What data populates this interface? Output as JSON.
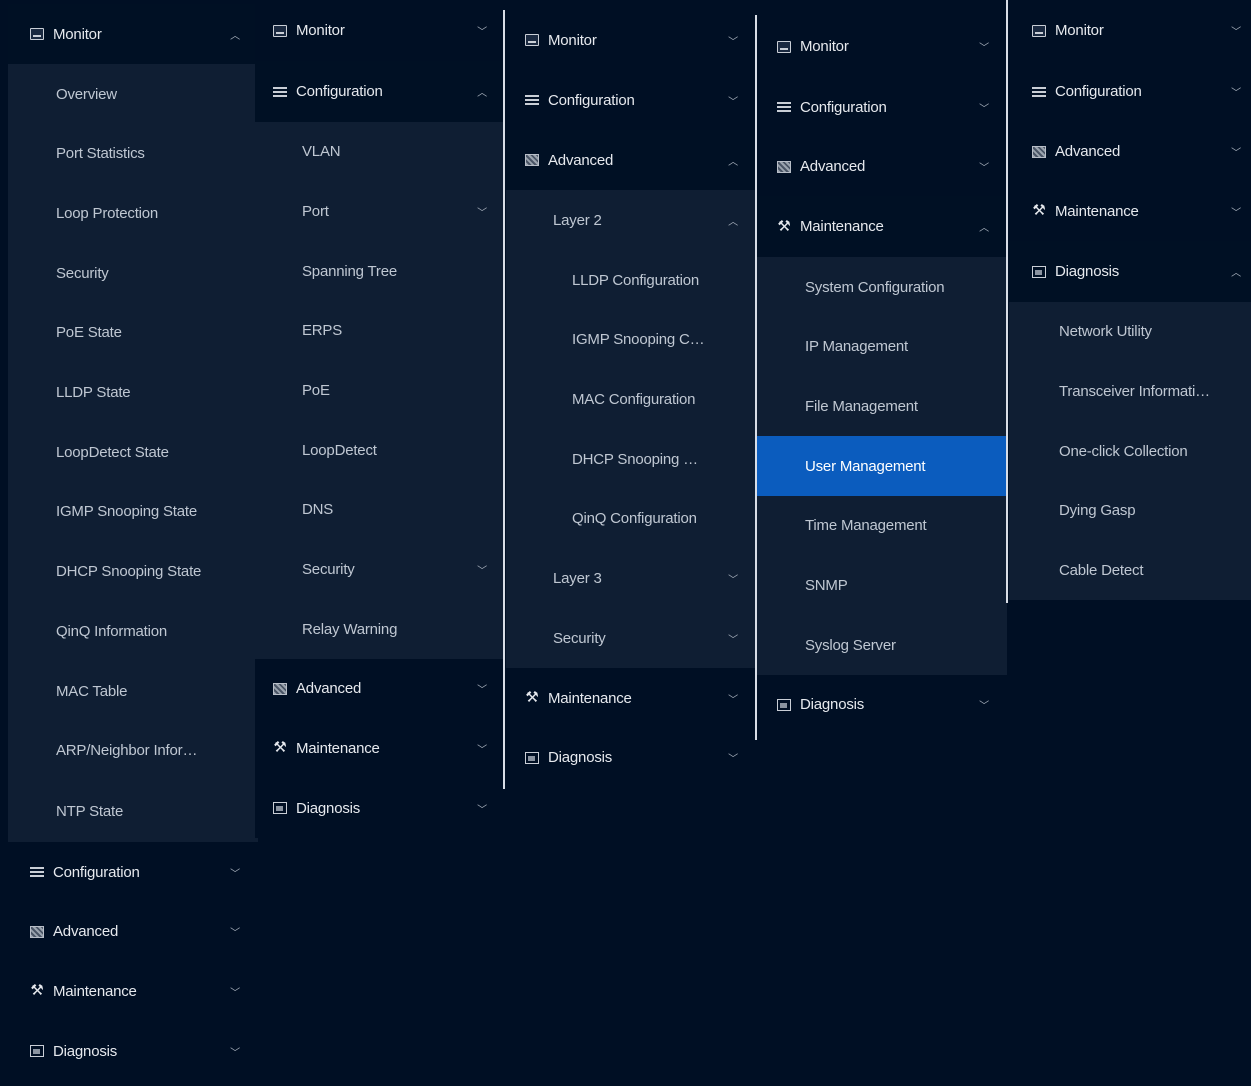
{
  "icons": {
    "monitor": "monitor-icon",
    "configuration": "configuration-icon",
    "advanced": "advanced-icon",
    "maintenance": "maintenance-icon",
    "diagnosis": "diagnosis-icon"
  },
  "colors": {
    "background": "#000f24",
    "submenu": "#0f1e33",
    "active": "#0b5cbe"
  },
  "panel1": {
    "monitor": "Monitor",
    "items": [
      "Overview",
      "Port Statistics",
      "Loop Protection",
      "Security",
      "PoE State",
      "LLDP State",
      "LoopDetect State",
      "IGMP Snooping State",
      "DHCP Snooping State",
      "QinQ Information",
      "MAC Table",
      "ARP/Neighbor Infor…",
      "NTP State"
    ],
    "configuration": "Configuration",
    "advanced": "Advanced",
    "maintenance": "Maintenance",
    "diagnosis": "Diagnosis"
  },
  "panel2": {
    "monitor": "Monitor",
    "configuration": "Configuration",
    "items": [
      "VLAN",
      "Port",
      "Spanning Tree",
      "ERPS",
      "PoE",
      "LoopDetect",
      "DNS",
      "Security",
      "Relay Warning"
    ],
    "advanced": "Advanced",
    "maintenance": "Maintenance",
    "diagnosis": "Diagnosis"
  },
  "panel3": {
    "monitor": "Monitor",
    "configuration": "Configuration",
    "advanced": "Advanced",
    "layer2": "Layer 2",
    "layer2_items": [
      "LLDP Configuration",
      "IGMP Snooping C…",
      "MAC Configuration",
      "DHCP Snooping …",
      "QinQ Configuration"
    ],
    "layer3": "Layer 3",
    "security": "Security",
    "maintenance": "Maintenance",
    "diagnosis": "Diagnosis"
  },
  "panel4": {
    "monitor": "Monitor",
    "configuration": "Configuration",
    "advanced": "Advanced",
    "maintenance": "Maintenance",
    "items": [
      "System Configuration",
      "IP Management",
      "File Management",
      "User Management",
      "Time Management",
      "SNMP",
      "Syslog Server"
    ],
    "diagnosis": "Diagnosis"
  },
  "panel5": {
    "monitor": "Monitor",
    "configuration": "Configuration",
    "advanced": "Advanced",
    "maintenance": "Maintenance",
    "diagnosis": "Diagnosis",
    "items": [
      "Network Utility",
      "Transceiver Informati…",
      "One-click Collection",
      "Dying Gasp",
      "Cable Detect"
    ]
  }
}
